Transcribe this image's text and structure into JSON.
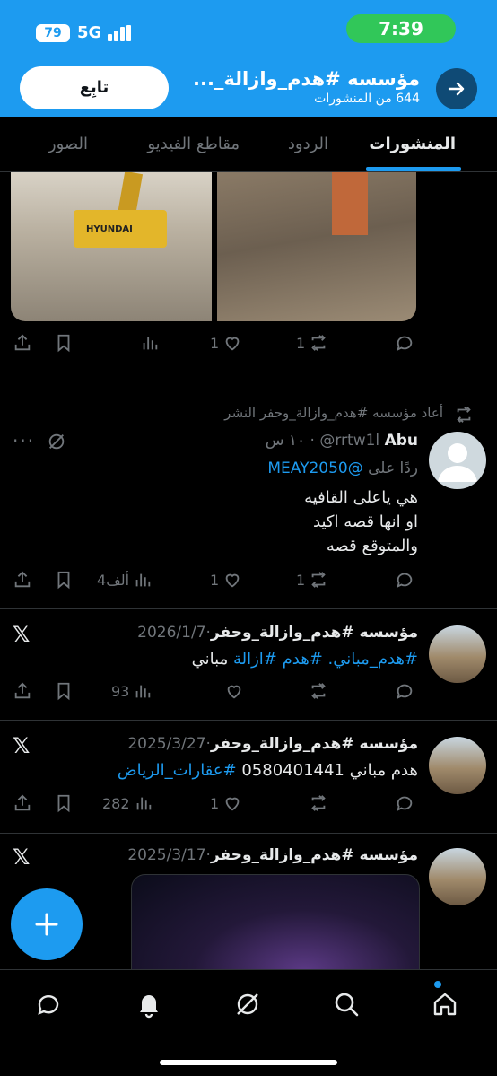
{
  "status_bar": {
    "battery": "79",
    "network": "5G",
    "time": "7:39"
  },
  "header": {
    "title": "مؤسسه #هدم_وازالة_...",
    "subtitle": "644 من المنشورات",
    "follow_label": "تابِع"
  },
  "tabs": [
    "المنشورات",
    "الردود",
    "مقاطع الفيديو",
    "الصور"
  ],
  "first_post_actions": {
    "likes": "1",
    "reposts": "1"
  },
  "repost_post": {
    "reposted_by": "أعاد مؤسسه #هدم_وازالة_وحفر النشر",
    "author": "Abu",
    "handle": "@rrtw1l",
    "time": "١٠ س",
    "reply_to_prefix": "ردًا على",
    "reply_to_handle": "@MEAY2050",
    "lines": [
      "هي ياعلى القافيه",
      "او انها قصه اكيد",
      "والمتوقع قصه"
    ],
    "views": "4ألف",
    "likes": "1",
    "reposts": "1"
  },
  "post2": {
    "author": "مؤسسه #هدم_وازالة_وحفر",
    "date": "2026/1/7",
    "hashtags": [
      "#هدم_مباني.",
      "#هدم",
      "#ازالة"
    ],
    "suffix": "مباني",
    "views": "93"
  },
  "post3": {
    "author": "مؤسسه #هدم_وازالة_وحفر",
    "date": "2025/3/27",
    "text": "هدم مباني 0580401441",
    "hashtag": "#عقارات_الرياض",
    "views": "282",
    "likes": "1"
  },
  "post4": {
    "author": "مؤسسه #هدم_وازالة_وحفر",
    "date": "2025/3/17"
  },
  "media_labels": {
    "excavator_brand": "HYUNDAI"
  },
  "colors": {
    "accent": "#1d9bf0",
    "background": "#000000",
    "muted": "#71767b",
    "clock_pill": "#31c759"
  },
  "nav": [
    "messages-icon",
    "notifications-icon",
    "grok-icon",
    "search-icon",
    "home-icon"
  ]
}
